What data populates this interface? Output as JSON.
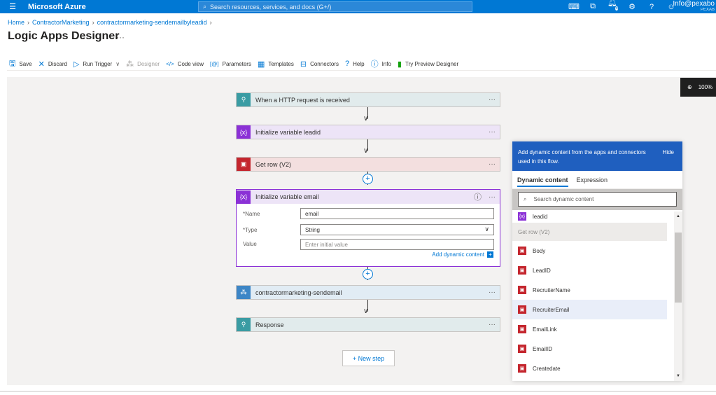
{
  "topbar": {
    "brand": "Microsoft Azure",
    "search_placeholder": "Search resources, services, and docs (G+/)",
    "notification_count": "5",
    "account_name": "Info@pexabo",
    "account_tenant": "PEXAB"
  },
  "breadcrumb": [
    "Home",
    "ContractorMarketing",
    "contractormarketing-sendemailbyleadid"
  ],
  "page": {
    "title": "Logic Apps Designer"
  },
  "toolbar": {
    "save": "Save",
    "discard": "Discard",
    "run_trigger": "Run Trigger",
    "designer": "Designer",
    "code_view": "Code view",
    "parameters": "Parameters",
    "templates": "Templates",
    "connectors": "Connectors",
    "help": "Help",
    "info": "Info",
    "try_preview": "Try Preview Designer"
  },
  "zoom": {
    "level": "100%"
  },
  "steps": {
    "http": "When a HTTP request is received",
    "init_leadid": "Initialize variable leadid",
    "get_row": "Get row (V2)",
    "init_email": "Initialize variable email",
    "sendemail": "contractormarketing-sendemail",
    "response": "Response"
  },
  "email_form": {
    "name_label": "*Name",
    "name_value": "email",
    "type_label": "*Type",
    "type_value": "String",
    "value_label": "Value",
    "value_placeholder": "Enter initial value",
    "add_dynamic": "Add dynamic content"
  },
  "new_step": "+ New step",
  "dynamic_panel": {
    "header": "Add dynamic content from the apps and connectors used in this flow.",
    "hide": "Hide",
    "tab_dynamic": "Dynamic content",
    "tab_expression": "Expression",
    "search_placeholder": "Search dynamic content",
    "first_item": "leadid",
    "group": "Get row (V2)",
    "items": [
      "Body",
      "LeadID",
      "RecruiterName",
      "RecruiterEmail",
      "EmailLink",
      "EmailID",
      "Createdate"
    ]
  }
}
